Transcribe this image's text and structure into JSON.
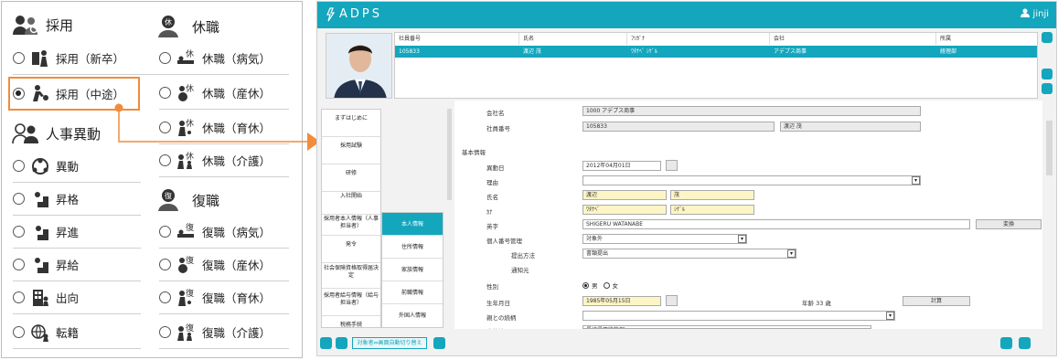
{
  "menu": {
    "saiyo": {
      "title": "採用",
      "items": [
        {
          "label": "採用（新卒）",
          "checked": false
        },
        {
          "label": "採用（中途）",
          "checked": true
        }
      ]
    },
    "jinji": {
      "title": "人事異動",
      "items": [
        {
          "label": "異動"
        },
        {
          "label": "昇格"
        },
        {
          "label": "昇進"
        },
        {
          "label": "昇給"
        },
        {
          "label": "出向"
        },
        {
          "label": "転籍"
        }
      ]
    },
    "kyushoku": {
      "title": "休職",
      "items": [
        {
          "label": "休職（病気）"
        },
        {
          "label": "休職（産休）"
        },
        {
          "label": "休職（育休）"
        },
        {
          "label": "休職（介護）"
        }
      ]
    },
    "fukushoku": {
      "title": "復職",
      "items": [
        {
          "label": "復職（病気）"
        },
        {
          "label": "復職（産休）"
        },
        {
          "label": "復職（育休）"
        },
        {
          "label": "復職（介護）"
        }
      ]
    }
  },
  "app": {
    "title": "ADPS",
    "user": "jinji",
    "accent": "#13a6bd",
    "grid": {
      "headers": [
        "社員番号",
        "氏名",
        "ﾌﾘｶﾞﾅ",
        "会社",
        "所属"
      ],
      "row": [
        "105833",
        "渡辺 茂",
        "ﾜﾀﾅﾍﾞ ｼｹﾞﾙ",
        "アデプス商事",
        "経理部"
      ]
    },
    "steps": [
      "まずはじめに",
      "採用試験",
      "研修",
      "入社開始",
      "採用者本人情報（人事担当者）",
      "発令",
      "社会保険資格取得届決定",
      "採用者給与情報（給与担当者）",
      "税務手続"
    ],
    "subtabs": [
      "本人情報",
      "住所情報",
      "家族情報",
      "前職情報",
      "外国人情報"
    ],
    "form": {
      "company_label": "会社名",
      "company_value": "1000 アデプス商事",
      "empno_label": "社員番号",
      "empno_value": "105833",
      "empno_name": "渡辺 茂",
      "basic_label": "基本情報",
      "idou_label": "異動日",
      "idou_value": "2012年04月01日",
      "riyu_label": "理由",
      "name_label": "氏名",
      "name_sei": "渡辺",
      "name_mei": "茂",
      "kana_label": "ｶﾅ",
      "kana_sei": "ﾜﾀﾅﾍﾞ",
      "kana_mei": "ｼｹﾞﾙ",
      "eiji_label": "英字",
      "eiji_value": "SHIGERU WATANABE",
      "henkan": "変換",
      "mynumber_label": "個人番号管理",
      "mynumber_value": "対象外",
      "teishutsu_label": "提出方法",
      "teishutsu_value": "書類提出",
      "tsuchi_label": "通知元",
      "sex_label": "性別",
      "sex_male": "男",
      "sex_female": "女",
      "birth_label": "生年月日",
      "birth_value": "1985年05月15日",
      "age_label": "年齢 33 歳",
      "calc": "計算",
      "rel_label": "親との続柄",
      "honseki_label": "本籍地",
      "honseki_value": "長崎県西彼杵郡"
    },
    "bottom_btn": "対象者⇔画面自動切り替え"
  }
}
